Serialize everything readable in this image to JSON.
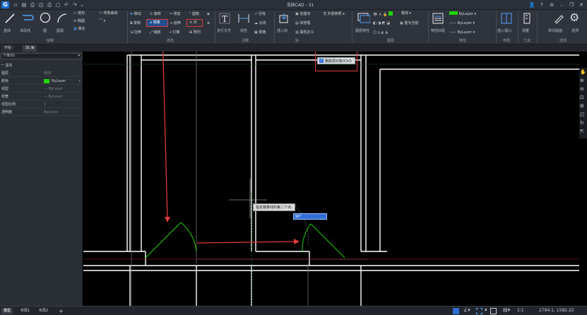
{
  "app": {
    "title": "浩辰CAD - 31",
    "logo": "G"
  },
  "quick_access": [
    "▫",
    "▤",
    "⎙",
    "◫",
    "⎙",
    "▢",
    "↶",
    "↷",
    "⌄"
  ],
  "window_controls": [
    "👤",
    "?",
    "⊖",
    "–",
    "❐",
    "✕"
  ],
  "ribbon": {
    "groups": [
      {
        "label": "绘制"
      },
      {
        "label": "修改"
      },
      {
        "label": "注释"
      },
      {
        "label": "块"
      },
      {
        "label": "图层"
      },
      {
        "label": "特性"
      },
      {
        "label": "布局"
      },
      {
        "label": "工具"
      },
      {
        "label": "选项"
      }
    ],
    "draw": {
      "line": "直线",
      "polyline": "多段线",
      "circle": "圆",
      "arc": "圆弧",
      "rect": "矩形",
      "ellipse": "椭圆",
      "hatch": "填充",
      "spline": "样条曲线"
    },
    "modify": {
      "move": "移动",
      "rotate": "旋转",
      "trim": "修剪",
      "fillet": "圆角",
      "copy": "复制",
      "mirror": "镜像",
      "extend": "延伸",
      "point": "点",
      "stretch": "拉伸",
      "scale": "缩放",
      "break": "打断",
      "array": "阵列"
    },
    "annot": {
      "mtext": "多行文字",
      "dim": "线性",
      "leader": "引线",
      "cloud": "云线",
      "table": "表格"
    },
    "block": {
      "insert": "插入块",
      "create": "创建块",
      "manage": "块管理",
      "attr": "属性定义",
      "xref": "外部参照",
      "insert2": "插入"
    },
    "layer": {
      "props": "图层特性",
      "current": "置为当前",
      "name": "粗线"
    },
    "props": {
      "match": "特性匹配",
      "bylayer": "ByLayer"
    },
    "layout": {
      "insert": "插入视口"
    },
    "tools": {
      "measure": "测量"
    },
    "options": {
      "style": "样式版面",
      "opts": "选项"
    }
  },
  "doc_tabs": [
    {
      "label": "开始"
    },
    {
      "label": "31"
    }
  ],
  "panel": {
    "selector": "个体(0)",
    "section": "一 基本",
    "rows": [
      {
        "k": "图层",
        "v": "粗线"
      },
      {
        "k": "颜色",
        "v": "ByLayer",
        "swatch": "#21d400"
      },
      {
        "k": "线型",
        "v": "— ByLayer"
      },
      {
        "k": "线宽",
        "v": "— ByLayer"
      },
      {
        "k": "线型比例",
        "v": "1"
      },
      {
        "k": "透明度",
        "v": "ByLayer"
      }
    ]
  },
  "canvas": {
    "erase_checkbox_label": "删除源对象(Ctrl)",
    "prompt": "指定镜像线的第二个点:",
    "angle_input": "90°"
  },
  "status": {
    "layout_tabs": [
      {
        "label": "模型"
      },
      {
        "label": "布局1"
      },
      {
        "label": "布局2"
      },
      {
        "label": "+"
      }
    ],
    "scale": "1:1",
    "coords": "2794.1, 1582.22"
  },
  "colors": {
    "highlight": "#e03a3a",
    "cad_green": "#1fd400",
    "accent": "#3b8ff0"
  }
}
